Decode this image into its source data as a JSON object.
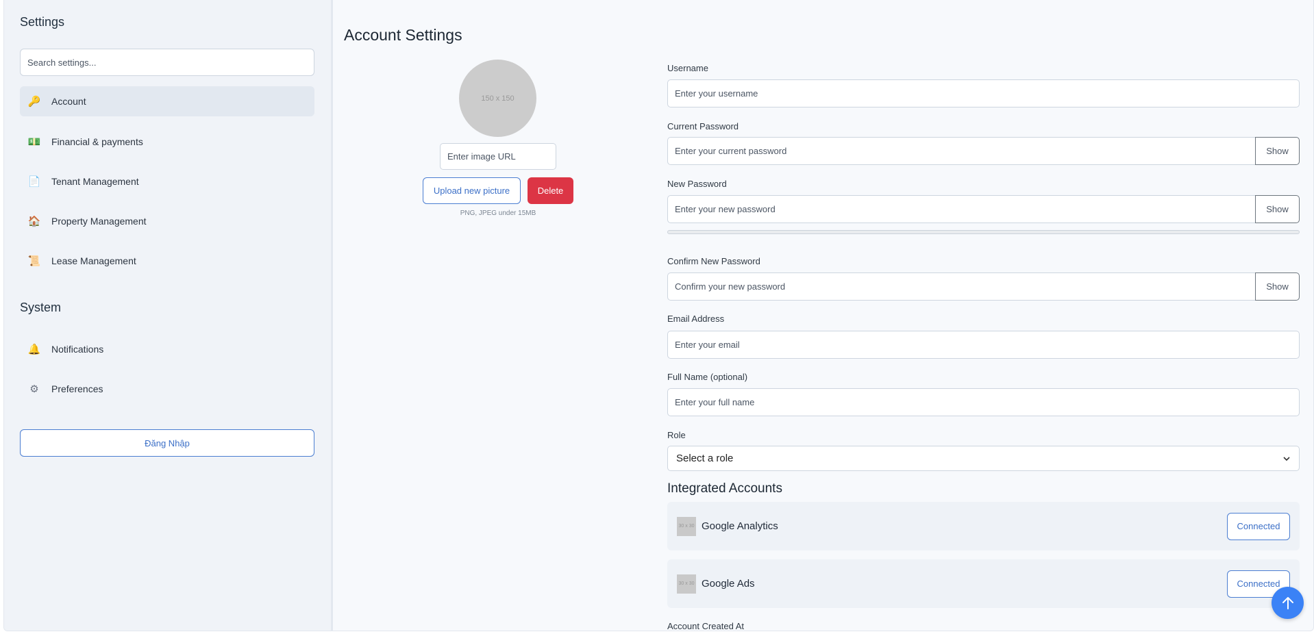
{
  "sidebar": {
    "title": "Settings",
    "search_placeholder": "Search settings...",
    "items": [
      {
        "label": "Account",
        "icon": "key-icon"
      },
      {
        "label": "Financial & payments",
        "icon": "money-icon"
      },
      {
        "label": "Tenant Management",
        "icon": "clipboard-icon"
      },
      {
        "label": "Property Management",
        "icon": "house-icon"
      },
      {
        "label": "Lease Management",
        "icon": "scroll-icon"
      }
    ],
    "system_title": "System",
    "system_items": [
      {
        "label": "Notifications",
        "icon": "bell-icon"
      },
      {
        "label": "Preferences",
        "icon": "gear-icon"
      }
    ],
    "login_label": "Đăng Nhập"
  },
  "main": {
    "title": "Account Settings",
    "avatar_placeholder": "150 x 150",
    "image_url_placeholder": "Enter image URL",
    "upload_label": "Upload new picture",
    "delete_label": "Delete",
    "hint": "PNG, JPEG under 15MB",
    "fields": {
      "username": {
        "label": "Username",
        "placeholder": "Enter your username"
      },
      "current_password": {
        "label": "Current Password",
        "placeholder": "Enter your current password"
      },
      "new_password": {
        "label": "New Password",
        "placeholder": "Enter your new password"
      },
      "confirm_password": {
        "label": "Confirm New Password",
        "placeholder": "Confirm your new password"
      },
      "email": {
        "label": "Email Address",
        "placeholder": "Enter your email"
      },
      "full_name": {
        "label": "Full Name (optional)",
        "placeholder": "Enter your full name"
      },
      "role": {
        "label": "Role",
        "value": "Select a role"
      }
    },
    "show_label": "Show",
    "integrations_title": "Integrated Accounts",
    "integrations": [
      {
        "name": "Google Analytics",
        "logo": "30 x 30",
        "status": "Connected"
      },
      {
        "name": "Google Ads",
        "logo": "30 x 30",
        "status": "Connected"
      }
    ],
    "created_label": "Account Created At"
  },
  "colors": {
    "accent": "#3b82f6",
    "danger": "#dc3545",
    "sidebar_bg": "#f0f3f8"
  }
}
